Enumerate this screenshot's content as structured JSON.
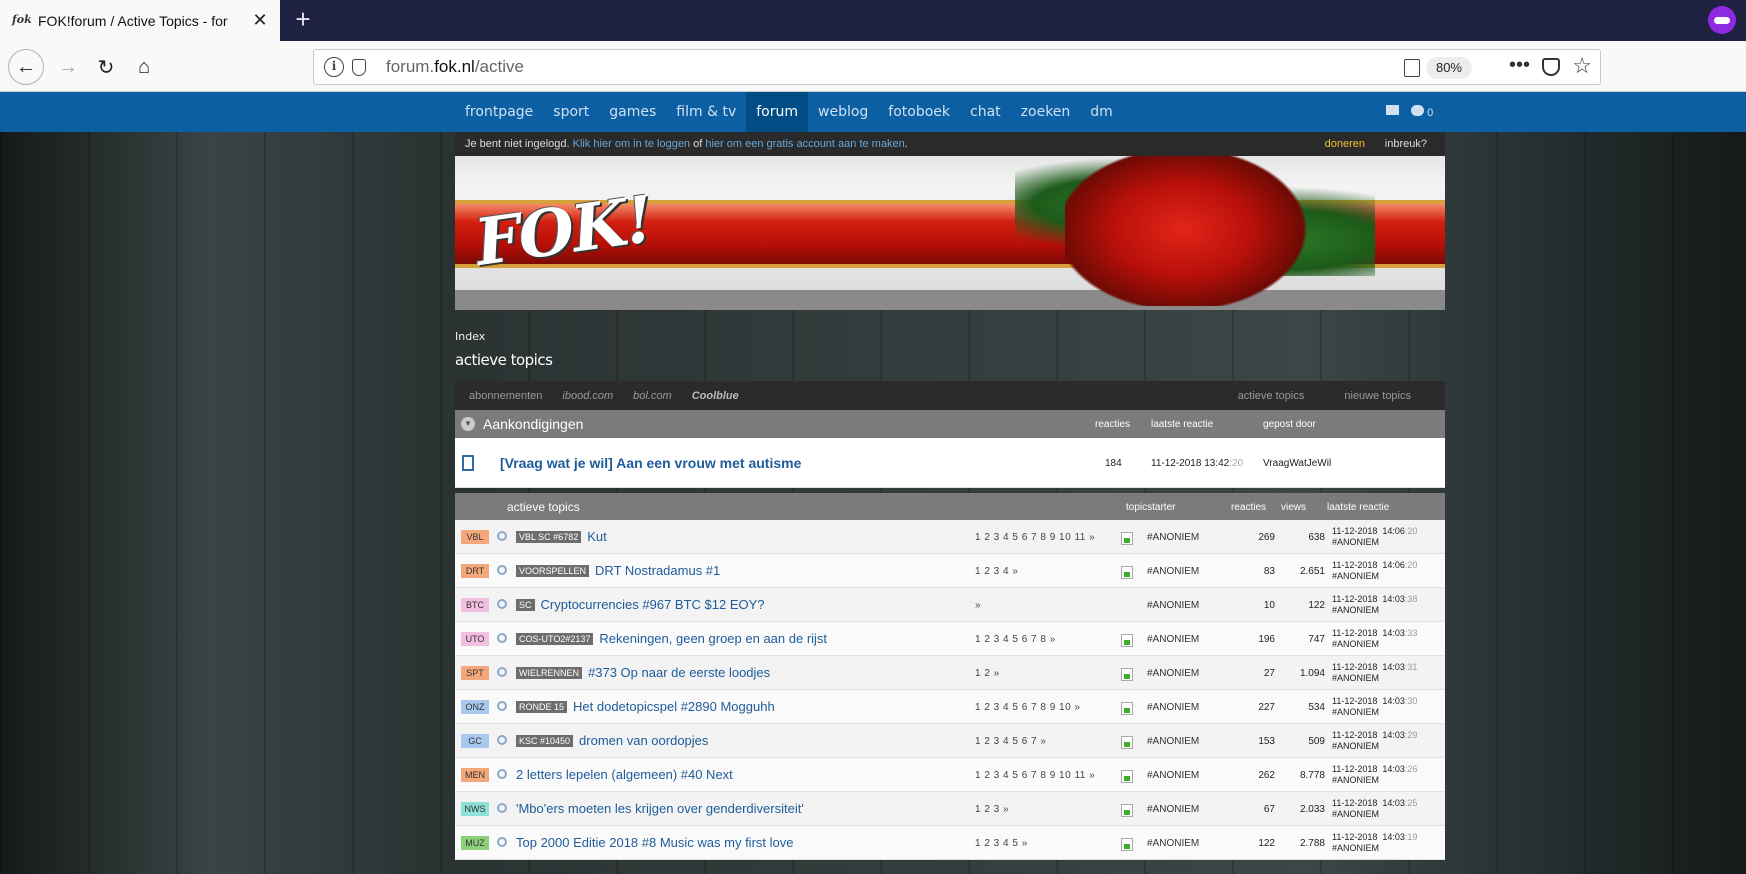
{
  "browser": {
    "tab_title": "FOK!forum / Active Topics - for",
    "url_domain_prefix": "forum.",
    "url_domain": "fok.nl",
    "url_path": "/active",
    "zoom": "80%",
    "favicon_text": "fok"
  },
  "site": {
    "nav": [
      "frontpage",
      "sport",
      "games",
      "film & tv",
      "forum",
      "weblog",
      "fotoboek",
      "chat",
      "zoeken",
      "dm"
    ],
    "nav_active_index": 4,
    "message_count": "0",
    "login": {
      "prefix": "Je bent niet ingelogd.",
      "login_link": "Klik hier om in te loggen",
      "middle": " of ",
      "register_link": "hier om een gratis account aan te maken",
      "suffix": ".",
      "donate": "doneren",
      "breach": "inbreuk?"
    },
    "logo_text": "FOK!",
    "breadcrumb": "Index",
    "page_title": "actieve topics",
    "subnav": {
      "left": [
        "abonnementen",
        "ibood.com",
        "bol.com",
        "Coolblue"
      ],
      "right": [
        "actieve topics",
        "nieuwe topics"
      ]
    },
    "announcements": {
      "title": "Aankondigingen",
      "col_replies": "reacties",
      "col_last": "laatste reactie",
      "col_by": "gepost door",
      "item": {
        "title": "[Vraag wat je wil] Aan een vrouw met autisme",
        "replies": "184",
        "last_date": "11-12-2018 13:42",
        "last_sec": ":20",
        "posted_by": "VraagWatJeWil"
      }
    },
    "topics": {
      "header": {
        "title": "actieve topics",
        "starter": "topicstarter",
        "replies": "reacties",
        "views": "views",
        "last": "laatste reactie"
      },
      "rows": [
        {
          "tag": "VBL",
          "tag_color": "#f4a77a",
          "prefix": "VBL SC #6782",
          "title": "Kut",
          "pages": "1 2 3 4 5 6 7 8 9 10 11 »",
          "new": true,
          "starter": "#ANONIEM",
          "replies": "269",
          "views": "638",
          "date": "11-12-2018",
          "time": "14:06",
          "sec": ":20",
          "last_by": "#ANONIEM"
        },
        {
          "tag": "DRT",
          "tag_color": "#f4a77a",
          "prefix": "VOORSPELLEN",
          "title": "DRT Nostradamus #1",
          "pages": "1 2 3 4 »",
          "new": true,
          "starter": "#ANONIEM",
          "replies": "83",
          "views": "2.651",
          "date": "11-12-2018",
          "time": "14:06",
          "sec": ":20",
          "last_by": "#ANONIEM"
        },
        {
          "tag": "BTC",
          "tag_color": "#f2bfe0",
          "prefix": "SC",
          "title": "Cryptocurrencies #967 BTC $12 EOY?",
          "pages": "»",
          "new": false,
          "starter": "#ANONIEM",
          "replies": "10",
          "views": "122",
          "date": "11-12-2018",
          "time": "14:03",
          "sec": ":38",
          "last_by": "#ANONIEM"
        },
        {
          "tag": "UTO",
          "tag_color": "#f2bfe0",
          "prefix": "COS-UTO2#2137",
          "title": "Rekeningen, geen groep en aan de rijst",
          "pages": "1 2 3 4 5 6 7 8 »",
          "new": true,
          "starter": "#ANONIEM",
          "replies": "196",
          "views": "747",
          "date": "11-12-2018",
          "time": "14:03",
          "sec": ":33",
          "last_by": "#ANONIEM"
        },
        {
          "tag": "SPT",
          "tag_color": "#f4a77a",
          "prefix": "WIELRENNEN",
          "title": "#373 Op naar de eerste loodjes",
          "pages": "1 2 »",
          "new": true,
          "starter": "#ANONIEM",
          "replies": "27",
          "views": "1.094",
          "date": "11-12-2018",
          "time": "14:03",
          "sec": ":31",
          "last_by": "#ANONIEM"
        },
        {
          "tag": "ONZ",
          "tag_color": "#a9c8ee",
          "prefix": "RONDE 15",
          "title": "Het dodetopicspel #2890 Mogguhh",
          "pages": "1 2 3 4 5 6 7 8 9 10 »",
          "new": true,
          "starter": "#ANONIEM",
          "replies": "227",
          "views": "534",
          "date": "11-12-2018",
          "time": "14:03",
          "sec": ":30",
          "last_by": "#ANONIEM"
        },
        {
          "tag": "GC",
          "tag_color": "#a9c8ee",
          "prefix": "KSC #10450",
          "title": "dromen van oordopjes",
          "pages": "1 2 3 4 5 6 7 »",
          "new": true,
          "starter": "#ANONIEM",
          "replies": "153",
          "views": "509",
          "date": "11-12-2018",
          "time": "14:03",
          "sec": ":29",
          "last_by": "#ANONIEM"
        },
        {
          "tag": "MEN",
          "tag_color": "#f4a77a",
          "prefix": "",
          "title": "2 letters lepelen (algemeen) #40 Next",
          "pages": "1 2 3 4 5 6 7 8 9 10 11 »",
          "new": true,
          "starter": "#ANONIEM",
          "replies": "262",
          "views": "8.778",
          "date": "11-12-2018",
          "time": "14:03",
          "sec": ":26",
          "last_by": "#ANONIEM"
        },
        {
          "tag": "NWS",
          "tag_color": "#8fe0d6",
          "prefix": "",
          "title": "'Mbo'ers moeten les krijgen over genderdiversiteit'",
          "pages": "1 2 3 »",
          "new": true,
          "starter": "#ANONIEM",
          "replies": "67",
          "views": "2.033",
          "date": "11-12-2018",
          "time": "14:03",
          "sec": ":25",
          "last_by": "#ANONIEM"
        },
        {
          "tag": "MUZ",
          "tag_color": "#8ed07a",
          "prefix": "",
          "title": "Top 2000 Editie 2018 #8 Music was my first love",
          "pages": "1 2 3 4 5 »",
          "new": true,
          "starter": "#ANONIEM",
          "replies": "122",
          "views": "2.788",
          "date": "11-12-2018",
          "time": "14:03",
          "sec": ":19",
          "last_by": "#ANONIEM"
        }
      ]
    }
  }
}
